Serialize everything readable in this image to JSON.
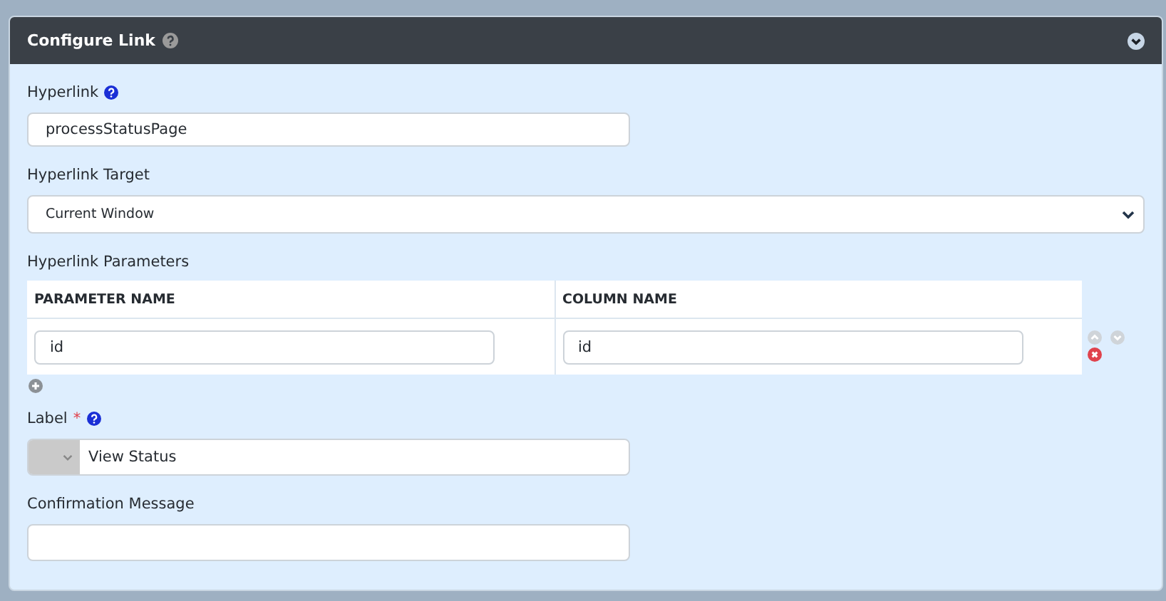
{
  "panel": {
    "title": "Configure Link"
  },
  "hyperlink": {
    "label": "Hyperlink",
    "value": "processStatusPage"
  },
  "target": {
    "label": "Hyperlink Target",
    "value": "Current Window"
  },
  "parameters": {
    "label": "Hyperlink Parameters",
    "columns": [
      "PARAMETER NAME",
      "COLUMN NAME"
    ],
    "rows": [
      [
        "id",
        "id"
      ]
    ]
  },
  "label_field": {
    "label": "Label",
    "required_mark": "*",
    "value": "View Status"
  },
  "confirmation": {
    "label": "Confirmation Message"
  }
}
